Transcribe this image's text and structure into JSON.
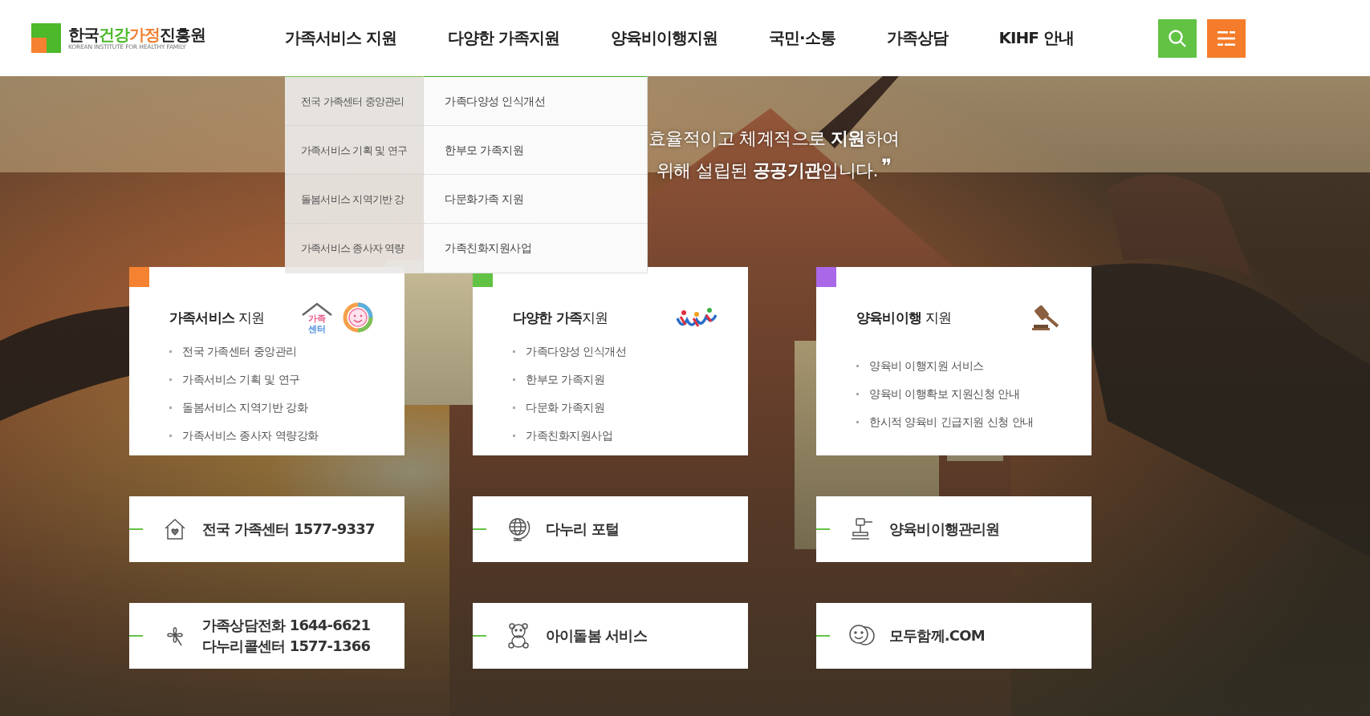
{
  "logo": {
    "parts": [
      {
        "text": "한국",
        "color": "#222222"
      },
      {
        "text": "건강",
        "color": "#4cb82a"
      },
      {
        "text": "가정",
        "color": "#f07d2e"
      },
      {
        "text": "진흥원",
        "color": "#222222"
      }
    ],
    "subtitle": "KOREAN INSTITUTE FOR HEALTHY FAMILY"
  },
  "nav": [
    "가족서비스 지원",
    "다양한 가족지원",
    "양육비이행지원",
    "국민·소통",
    "가족상담",
    "KIHF 안내"
  ],
  "dropdown": {
    "columns": [
      {
        "selected": false,
        "items": [
          "전국 가족센터 중앙관리",
          "가족서비스 기획 및 연구",
          "돌봄서비스 지역기반 강",
          "가족서비스 종사자 역량"
        ]
      },
      {
        "selected": true,
        "items": [
          "가족다양성 인식개선",
          "한부모 가족지원",
          "다문화가족 지원",
          "가족친화지원사업"
        ]
      }
    ]
  },
  "hero": {
    "lines": [
      "효율적이고 체계적으로 **지원**하여",
      "위해 설립된 **공공기관**입니다."
    ],
    "quote_mark": "❞"
  },
  "service_cards": [
    {
      "title": "**가족서비스** 지원",
      "color": "#f58230",
      "icon_text": [
        "가족",
        "센터"
      ],
      "items": [
        "전국 가족센터 중앙관리",
        "가족서비스 기획 및 연구",
        "돌봄서비스 지역기반 강화",
        "가족서비스 종사자 역량강화"
      ]
    },
    {
      "title": "**다양한 가족**지원",
      "color": "#62c244",
      "items": [
        "가족다양성 인식개선",
        "한부모 가족지원",
        "다문화 가족지원",
        "가족친화지원사업"
      ]
    },
    {
      "title": "**양육비이행** 지원",
      "color": "#a868e8",
      "items": [
        "양육비 이행지원 서비스",
        "양육비 이행확보 지원신청 안내",
        "한시적 양육비 긴급지원 신청 안내"
      ]
    }
  ],
  "link_cards": [
    {
      "lines": [
        "전국 가족센터 1577-9337"
      ]
    },
    {
      "lines": [
        "다누리 포털"
      ]
    },
    {
      "lines": [
        "양육비이행관리원"
      ]
    },
    {
      "lines": [
        "가족상담전화 1644-6621",
        "다누리콜센터 1577-1366"
      ]
    },
    {
      "lines": [
        "아이돌봄 서비스"
      ]
    },
    {
      "lines": [
        "모두함께.COM"
      ]
    }
  ]
}
